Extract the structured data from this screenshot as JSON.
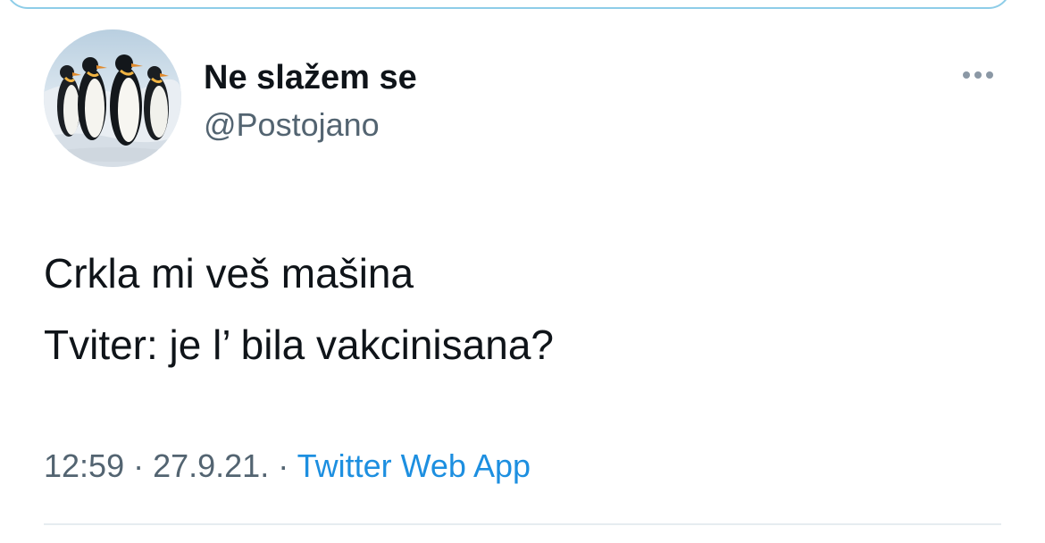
{
  "author": {
    "name": "Ne slažem se",
    "handle": "@Postojano"
  },
  "tweet": {
    "lines": [
      "Crkla mi veš mašina",
      "Tviter: je l’ bila vakcinisana?"
    ]
  },
  "meta": {
    "time": "12:59",
    "separator1": " · ",
    "date": "27.9.21.",
    "separator2": " · ",
    "source": "Twitter Web App"
  },
  "icons": {
    "more": "more-horizontal-icon",
    "avatar": "penguins-avatar"
  },
  "colors": {
    "link": "#1d8fe0",
    "secondary_text": "#536471",
    "primary_text": "#0f1419",
    "card_border": "#8ecde8"
  }
}
